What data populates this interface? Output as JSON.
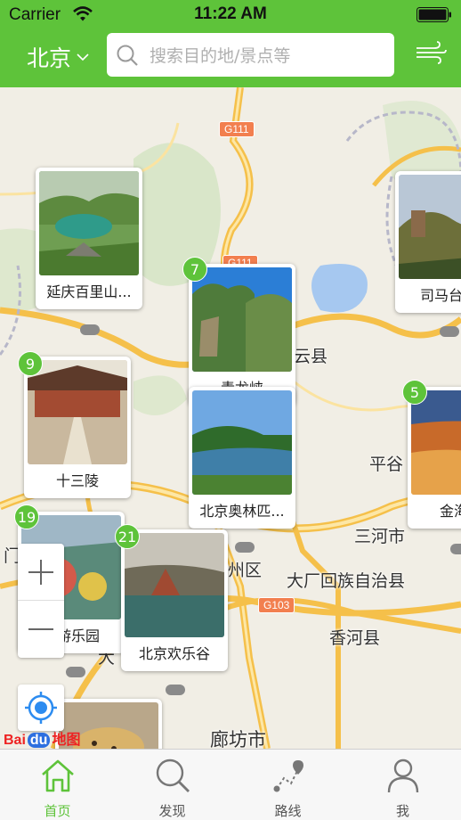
{
  "status_bar": {
    "carrier": "Carrier",
    "time": "11:22 AM"
  },
  "nav": {
    "city": "北京",
    "search_placeholder": "搜索目的地/景点等"
  },
  "map": {
    "place_labels": [
      "云县",
      "平谷",
      "三河市",
      "大厂回族自治县",
      "香河县",
      "廊坊市",
      "州区",
      "门",
      "大"
    ],
    "road_shields": [
      "G111",
      "G111",
      "G103"
    ],
    "attribution": "Bai du地图"
  },
  "pois": [
    {
      "name": "延庆百里山...",
      "badge": ""
    },
    {
      "name": "青龙峡",
      "badge": "7"
    },
    {
      "name": "司马台长",
      "badge": ""
    },
    {
      "name": "十三陵",
      "badge": "9"
    },
    {
      "name": "北京奥林匹...",
      "badge": ""
    },
    {
      "name": "金海湖",
      "badge": "5"
    },
    {
      "name": "山游乐园",
      "badge": "19"
    },
    {
      "name": "北京欢乐谷",
      "badge": "21"
    }
  ],
  "tabs": [
    {
      "label": "首页",
      "icon": "home-icon",
      "active": true
    },
    {
      "label": "发现",
      "icon": "search-icon",
      "active": false
    },
    {
      "label": "路线",
      "icon": "route-icon",
      "active": false
    },
    {
      "label": "我",
      "icon": "profile-icon",
      "active": false
    }
  ],
  "colors": {
    "brand_green": "#5ec33a",
    "road_orange": "#f5c04a",
    "water_blue": "#a6c8f0"
  }
}
